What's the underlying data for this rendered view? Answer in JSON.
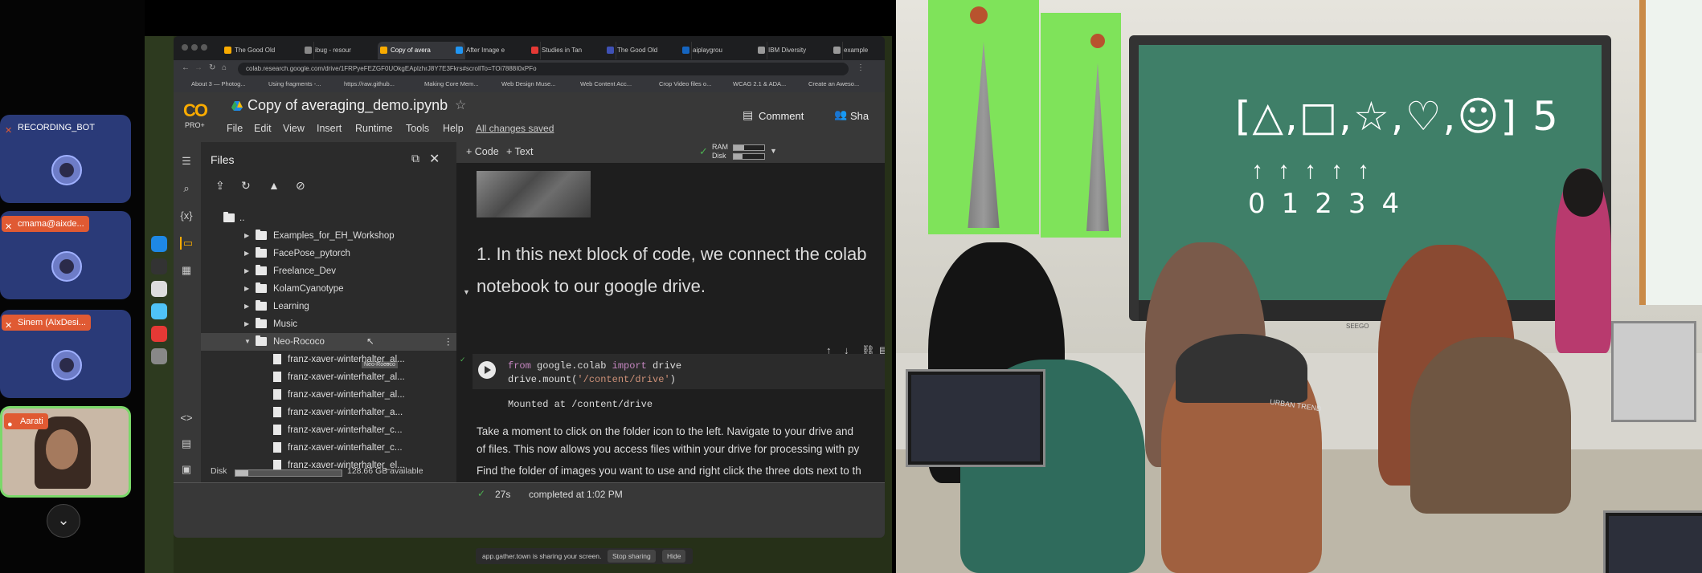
{
  "meeting": {
    "participants": [
      {
        "name": "RECORDING_BOT",
        "badge_color": "#2a3a78"
      },
      {
        "name": "cmama@aixde...",
        "badge_color": "#e05a33"
      },
      {
        "name": "Sinem (AIxDesi...",
        "badge_color": "#e05a33"
      },
      {
        "name": "Aarati",
        "badge_color": "#e05a33"
      }
    ],
    "expand_icon": "chevron-down-icon",
    "tile_color": "#2a3a78",
    "active_border": "#7bd86a"
  },
  "browser": {
    "tabs": [
      {
        "label": "The Good Old"
      },
      {
        "label": "ibug - resour"
      },
      {
        "label": "Copy of avera",
        "active": true
      },
      {
        "label": "After Image e"
      },
      {
        "label": "Studies in Tan"
      },
      {
        "label": "The Good Old"
      },
      {
        "label": "aiplaygrou"
      },
      {
        "label": "IBM Diversity"
      },
      {
        "label": "example"
      }
    ],
    "url": "colab.research.google.com/drive/1FRPyeFEZGF0UOkgEAplzhrJ8Y7E3Fkrs#scrollTo=TOi7888I0xPFo",
    "bookmarks": [
      "About 3 — Photog...",
      "Using fragments -...",
      "https://raw.github...",
      "Making Core Mem...",
      "Web Design Muse...",
      "Web Content Acc...",
      "Crop Video files o...",
      "WCAG 2.1 & ADA...",
      "Create an Aweso..."
    ]
  },
  "colab": {
    "logo": "CO",
    "plan": "PRO+",
    "title": "Copy of averaging_demo.ipynb",
    "menu": [
      "File",
      "Edit",
      "View",
      "Insert",
      "Runtime",
      "Tools",
      "Help"
    ],
    "save_status": "All changes saved",
    "comment_label": "Comment",
    "share_label": "Sha",
    "files_panel": {
      "title": "Files",
      "parent_label": "..",
      "items": [
        {
          "name": "Examples_for_EH_Workshop",
          "type": "folder"
        },
        {
          "name": "FacePose_pytorch",
          "type": "folder"
        },
        {
          "name": "Freelance_Dev",
          "type": "folder"
        },
        {
          "name": "KolamCyanotype",
          "type": "folder"
        },
        {
          "name": "Learning",
          "type": "folder"
        },
        {
          "name": "Music",
          "type": "folder"
        },
        {
          "name": "Neo-Rococo",
          "type": "folder",
          "expanded": true,
          "selected": true
        },
        {
          "name": "franz-xaver-winterhalter_al...",
          "type": "file"
        },
        {
          "name": "franz-xaver-winterhalter_al...",
          "type": "file"
        },
        {
          "name": "franz-xaver-winterhalter_al...",
          "type": "file"
        },
        {
          "name": "franz-xaver-winterhalter_a...",
          "type": "file"
        },
        {
          "name": "franz-xaver-winterhalter_c...",
          "type": "file"
        },
        {
          "name": "franz-xaver-winterhalter_c...",
          "type": "file"
        },
        {
          "name": "franz-xaver-winterhalter_el...",
          "type": "file"
        }
      ],
      "tooltip": "Neo-Rococo",
      "disk_label": "Disk",
      "disk_value": "128.66 GB available",
      "disk_used_fraction": 0.12
    },
    "toolbar": {
      "add_code": "+ Code",
      "add_text": "+ Text",
      "ram_label": "RAM",
      "disk_label": "Disk",
      "ram_fraction": 0.35,
      "disk_fraction": 0.3
    },
    "heading": "1. In this next block of code, we connect the colab notebook to our google drive.",
    "code": {
      "kw_from": "from",
      "module": " google.colab ",
      "kw_import": "import",
      "name": " drive",
      "line2_prefix": "drive.mount(",
      "line2_str": "'/content/drive'",
      "line2_suffix": ")"
    },
    "output": "Mounted at /content/drive",
    "text1": "Take a moment to click on the folder icon to the left. Navigate to your drive and",
    "text1b": "of files. This now allows you access files within your drive for processing with py",
    "text2": "Find the folder of images you want to use and right click the three dots next to th",
    "status_time": "27s",
    "status_text": "completed at 1:02 PM"
  },
  "screenshare_bar": {
    "text": "app.gather.town is sharing your screen.",
    "stop": "Stop sharing",
    "hide": "Hide"
  },
  "photo": {
    "board_row1": "[△,□,☆,♡,☺] 5",
    "board_row2": "↑↑↑↑↑",
    "board_row3": "01234",
    "board_brand": "SEEGO",
    "cap_text": "URBAN TREND"
  }
}
